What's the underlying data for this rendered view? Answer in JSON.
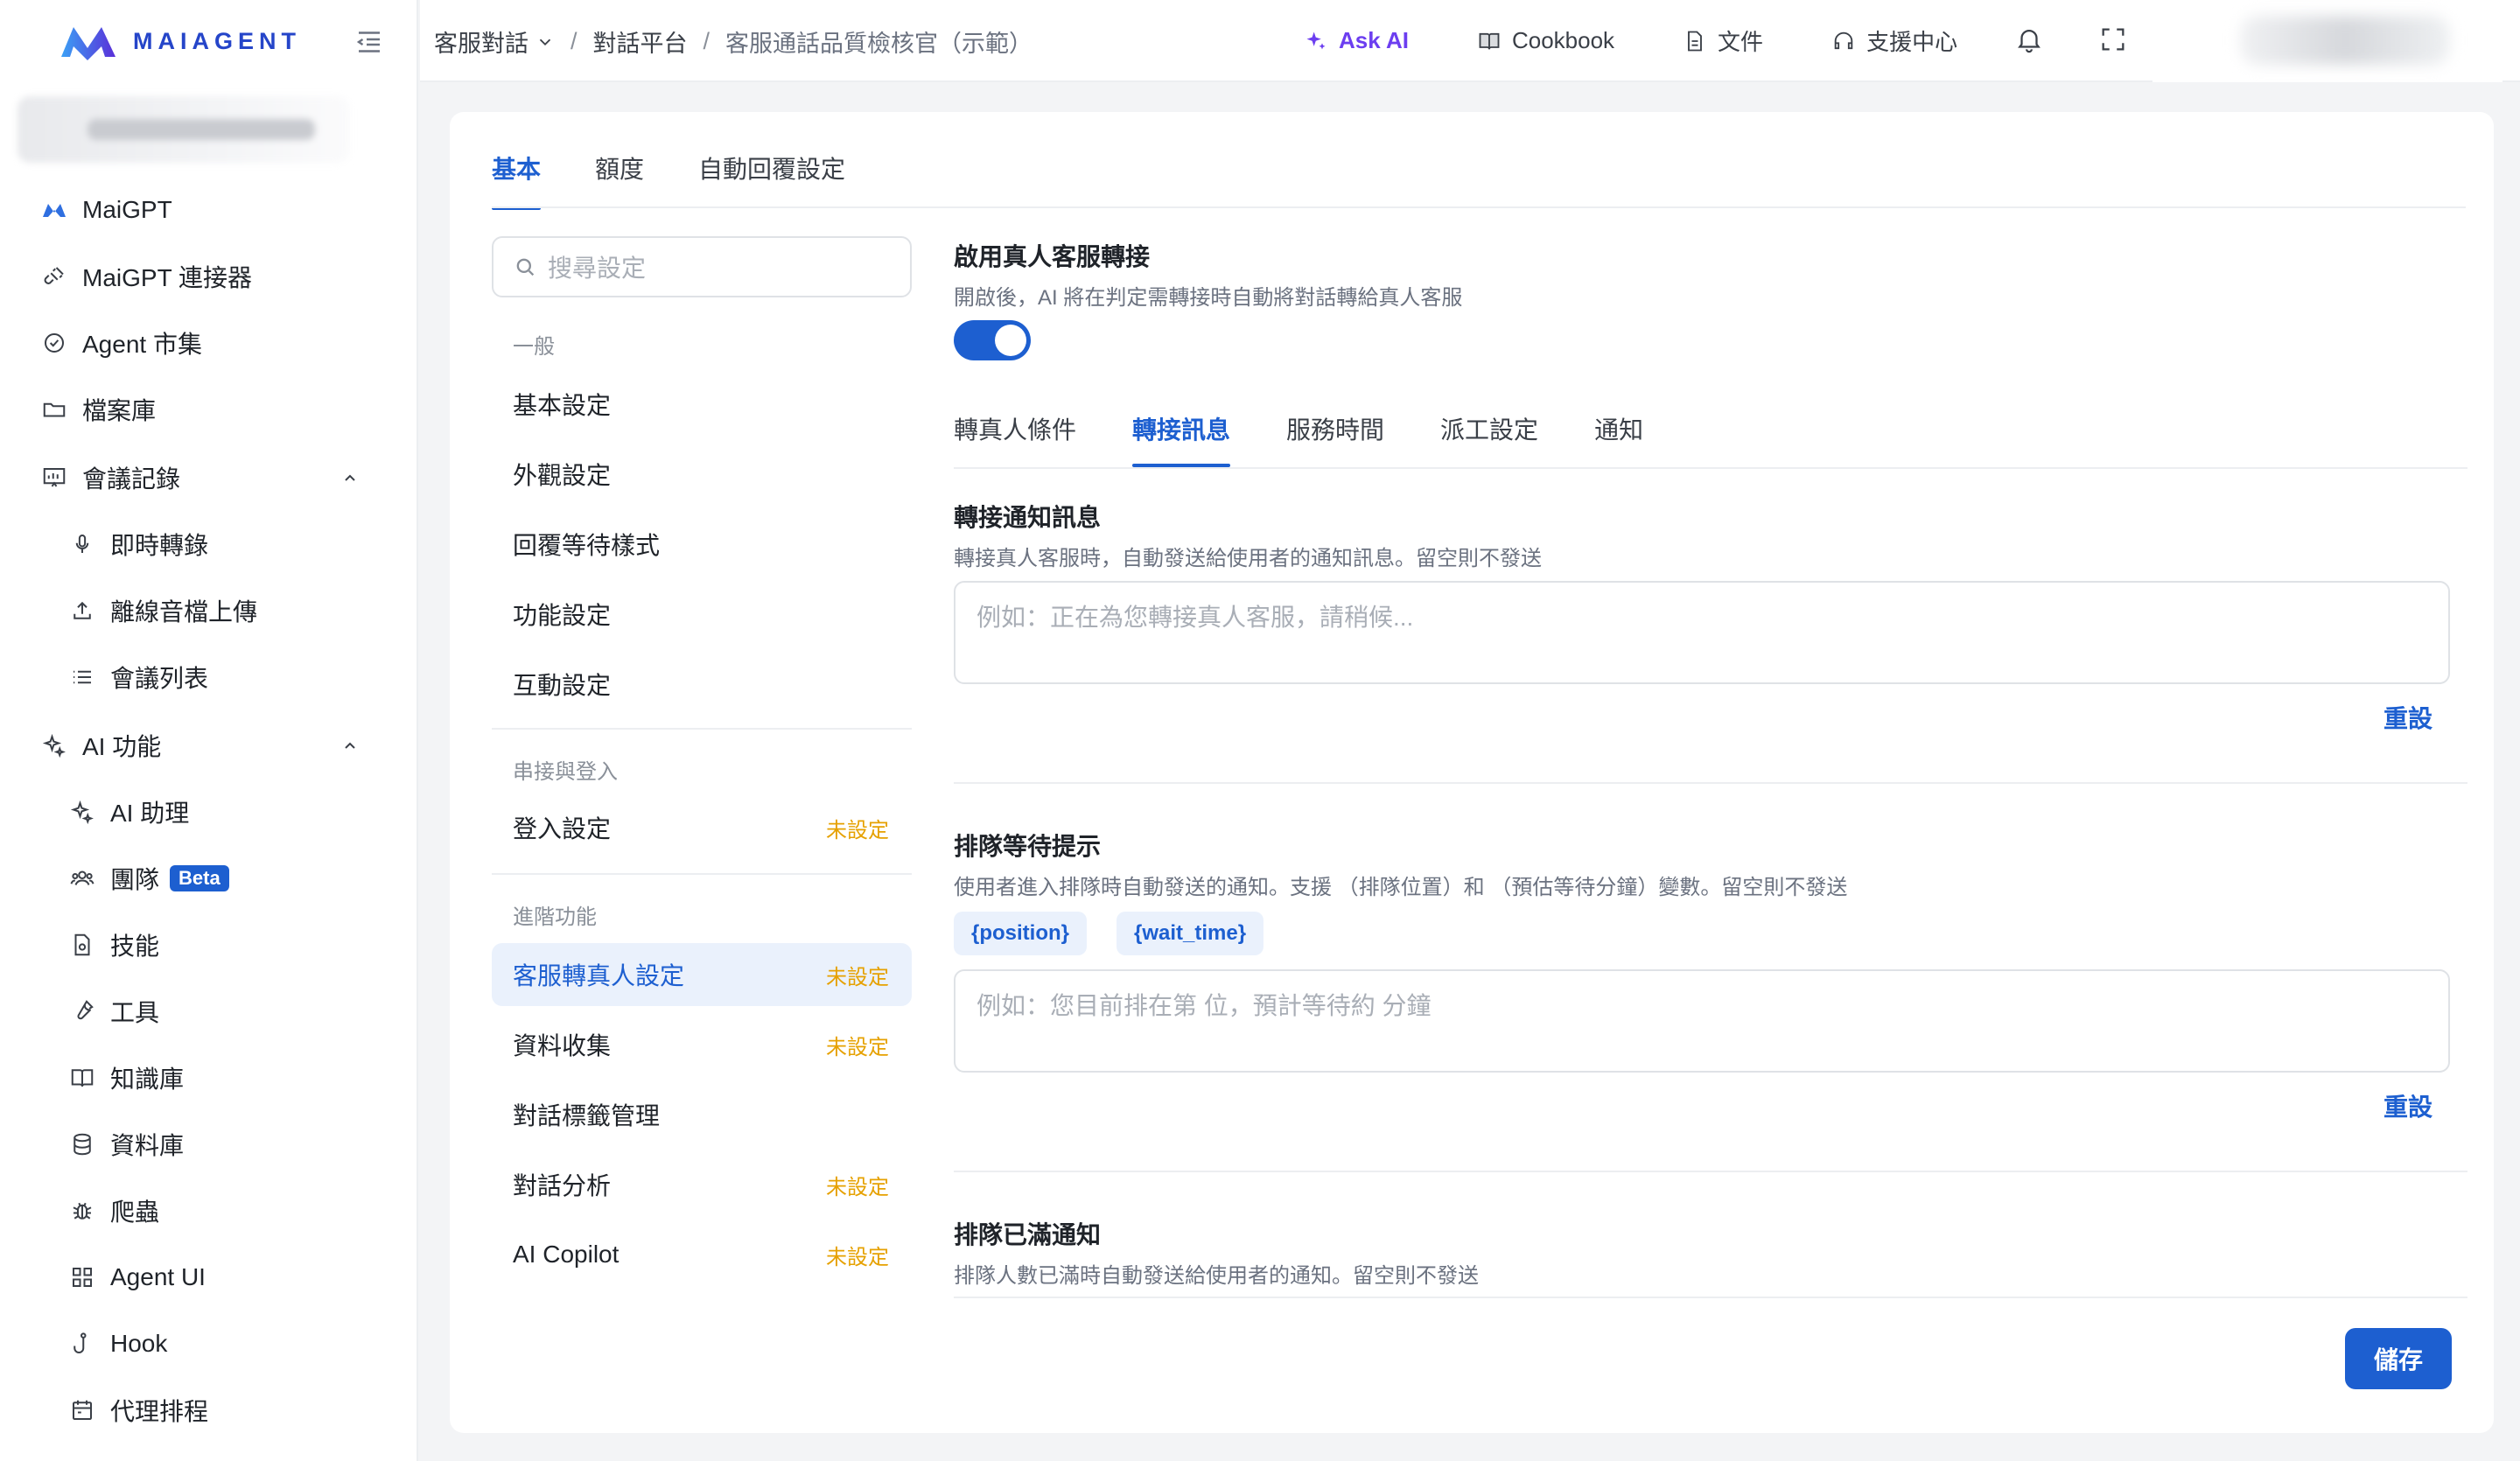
{
  "brand": {
    "name": "MAIAGENT",
    "accent": "#1d5fd0",
    "ai_color": "#6c3ef0",
    "warn": "#e6a100"
  },
  "sidebar": {
    "items": [
      {
        "label": "MaiGPT",
        "icon": "maigpt-logo-icon"
      },
      {
        "label": "MaiGPT 連接器",
        "icon": "plug-icon"
      },
      {
        "label": "Agent 市集",
        "icon": "badge-check-icon"
      },
      {
        "label": "檔案庫",
        "icon": "folder-icon"
      },
      {
        "label": "會議記錄",
        "icon": "presentation-icon",
        "expanded": true
      },
      {
        "label": "即時轉錄",
        "icon": "mic-icon"
      },
      {
        "label": "離線音檔上傳",
        "icon": "upload-icon"
      },
      {
        "label": "會議列表",
        "icon": "list-icon"
      },
      {
        "label": "AI 功能",
        "icon": "sparkles-icon",
        "expanded": true
      },
      {
        "label": "AI 助理",
        "icon": "sparkles-icon"
      },
      {
        "label": "團隊",
        "icon": "users-icon",
        "badge": "Beta"
      },
      {
        "label": "技能",
        "icon": "skill-file-icon"
      },
      {
        "label": "工具",
        "icon": "wrench-icon"
      },
      {
        "label": "知識庫",
        "icon": "book-icon"
      },
      {
        "label": "資料庫",
        "icon": "database-icon"
      },
      {
        "label": "爬蟲",
        "icon": "bug-icon"
      },
      {
        "label": "Agent UI",
        "icon": "grid-icon"
      },
      {
        "label": "Hook",
        "icon": "hook-icon"
      },
      {
        "label": "代理排程",
        "icon": "calendar-icon"
      }
    ]
  },
  "topbar": {
    "crumbs": [
      "客服對話",
      "對話平台",
      "客服通話品質檢核官（示範）"
    ],
    "actions": [
      {
        "label": "Ask AI",
        "icon": "sparkle-icon"
      },
      {
        "label": "Cookbook",
        "icon": "book-open-icon"
      },
      {
        "label": "文件",
        "icon": "document-icon"
      },
      {
        "label": "支援中心",
        "icon": "headset-icon"
      }
    ]
  },
  "main": {
    "tabs": [
      "基本",
      "額度",
      "自動回覆設定"
    ],
    "search_placeholder": "搜尋設定",
    "groups": [
      {
        "title": "一般",
        "items": [
          {
            "label": "基本設定",
            "badge": ""
          },
          {
            "label": "外觀設定",
            "badge": ""
          },
          {
            "label": "回覆等待樣式",
            "badge": ""
          },
          {
            "label": "功能設定",
            "badge": ""
          },
          {
            "label": "互動設定",
            "badge": ""
          }
        ]
      },
      {
        "title": "串接與登入",
        "items": [
          {
            "label": "登入設定",
            "badge": "未設定"
          }
        ]
      },
      {
        "title": "進階功能",
        "items": [
          {
            "label": "客服轉真人設定",
            "badge": "未設定",
            "active": true
          },
          {
            "label": "資料收集",
            "badge": "未設定"
          },
          {
            "label": "對話標籤管理",
            "badge": ""
          },
          {
            "label": "對話分析",
            "badge": "未設定"
          },
          {
            "label": "AI Copilot",
            "badge": "未設定"
          }
        ]
      }
    ]
  },
  "panel": {
    "title": "啟用真人客服轉接",
    "desc": "開啟後，AI 將在判定需轉接時自動將對話轉給真人客服",
    "toggle_on": true,
    "subtabs": [
      "轉真人條件",
      "轉接訊息",
      "服務時間",
      "派工設定",
      "通知"
    ],
    "sections": [
      {
        "title": "轉接通知訊息",
        "desc": "轉接真人客服時，自動發送給使用者的通知訊息。留空則不發送",
        "placeholder": "例如：正在為您轉接真人客服，請稍候...",
        "reset": "重設"
      },
      {
        "title": "排隊等待提示",
        "desc": "使用者進入排隊時自動發送的通知。支援 （排隊位置）和 （預估等待分鐘）變數。留空則不發送",
        "chips": [
          "{position}",
          "{wait_time}"
        ],
        "placeholder": "例如：您目前排在第  位，預計等待約  分鐘",
        "reset": "重設"
      },
      {
        "title": "排隊已滿通知",
        "desc": "排隊人數已滿時自動發送給使用者的通知。留空則不發送"
      }
    ],
    "save": "儲存"
  }
}
